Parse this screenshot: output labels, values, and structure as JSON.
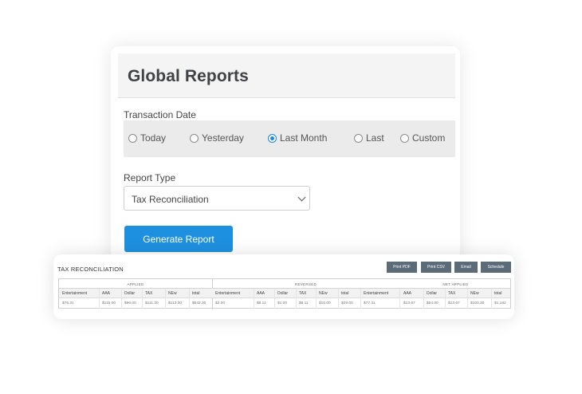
{
  "form": {
    "title": "Global Reports",
    "transaction_date_label": "Transaction Date",
    "radio_options": [
      {
        "label": "Today",
        "checked": false
      },
      {
        "label": "Yesterday",
        "checked": false
      },
      {
        "label": "Last Month",
        "checked": true
      },
      {
        "label": "Last",
        "checked": false
      },
      {
        "label": "Custom",
        "checked": false
      }
    ],
    "report_type_label": "Report Type",
    "report_type_value": "Tax Reconciliation",
    "generate_button": "Generate Report",
    "accent_color": "#1e90e0"
  },
  "report": {
    "title": "TAX RECONCILIATION",
    "actions": [
      "Print PDF",
      "Print CSV",
      "Email",
      "Schedule"
    ],
    "groups": [
      "APPLIED",
      "REVERSED",
      "NET APPLIED"
    ],
    "columns": [
      "Entertainment",
      "AAA",
      "Dollar",
      "TAX",
      "NEw",
      "total",
      "Entertainment",
      "AAA",
      "Dollar",
      "TAX",
      "NEw",
      "total",
      "Entertainment",
      "AAA",
      "Dollar",
      "TAX",
      "NEw",
      "total"
    ],
    "values": [
      "$76.31",
      "$115.00",
      "$96.00",
      "$111.30",
      "$113.30",
      "$542.30",
      "$2.00",
      "$8.11",
      "$1.00",
      "$8.11",
      "$10.00",
      "$29.00",
      "$77.31",
      "$13.67",
      "$54.00",
      "$13.67",
      "$103.30",
      "$1,182"
    ]
  }
}
